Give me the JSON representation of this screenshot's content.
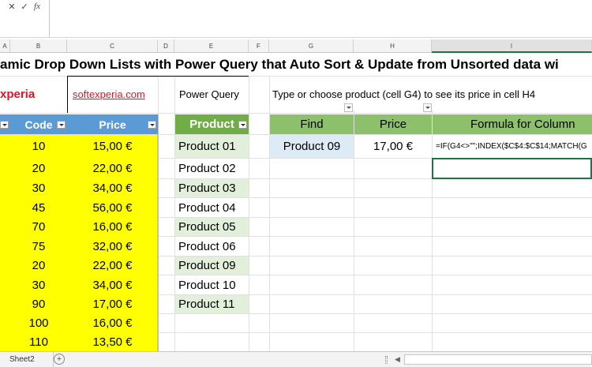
{
  "formula_bar": {
    "cancel_icon": "close-icon",
    "confirm_icon": "check-icon",
    "fx_label": "fx"
  },
  "columns": [
    "A",
    "B",
    "C",
    "D",
    "E",
    "F",
    "G",
    "H",
    "I"
  ],
  "title": "amic Drop Down Lists with Power Query that Auto Sort & Update from Unsorted data wi",
  "brand": "xperia",
  "link": "softexperia.com",
  "power_query_label": "Power Query",
  "instruction": "Type or choose product (cell G4) to see its price in cell H4",
  "source_table": {
    "headers": [
      "Code",
      "Price"
    ],
    "rows": [
      [
        "10",
        "15,00 €"
      ],
      [
        "20",
        "22,00 €"
      ],
      [
        "30",
        "34,00 €"
      ],
      [
        "45",
        "56,00 €"
      ],
      [
        "70",
        "16,00 €"
      ],
      [
        "75",
        "32,00 €"
      ],
      [
        "20",
        "22,00 €"
      ],
      [
        "30",
        "34,00 €"
      ],
      [
        "90",
        "17,00 €"
      ],
      [
        "100",
        "16,00 €"
      ],
      [
        "110",
        "13,50 €"
      ]
    ]
  },
  "product_table": {
    "header": "Product",
    "rows": [
      "Product 01",
      "Product 02",
      "Product 03",
      "Product 04",
      "Product 05",
      "Product 06",
      "Product 09",
      "Product 10",
      "Product 11"
    ]
  },
  "find_table": {
    "headers": [
      "Find",
      "Price",
      "Formula for Column"
    ],
    "find_value": "Product 09",
    "price_value": "17,00 €",
    "formula": "=IF(G4<>\"\";INDEX($C$4:$C$14;MATCH(G"
  },
  "sheet_tab": "Sheet2",
  "add_sheet_icon": "plus-circle-icon",
  "colors": {
    "yellow": "#ffff00",
    "blue": "#5b9bd5",
    "green": "#70ad47",
    "light_green": "#e2efda",
    "brand_red": "#e81123"
  }
}
